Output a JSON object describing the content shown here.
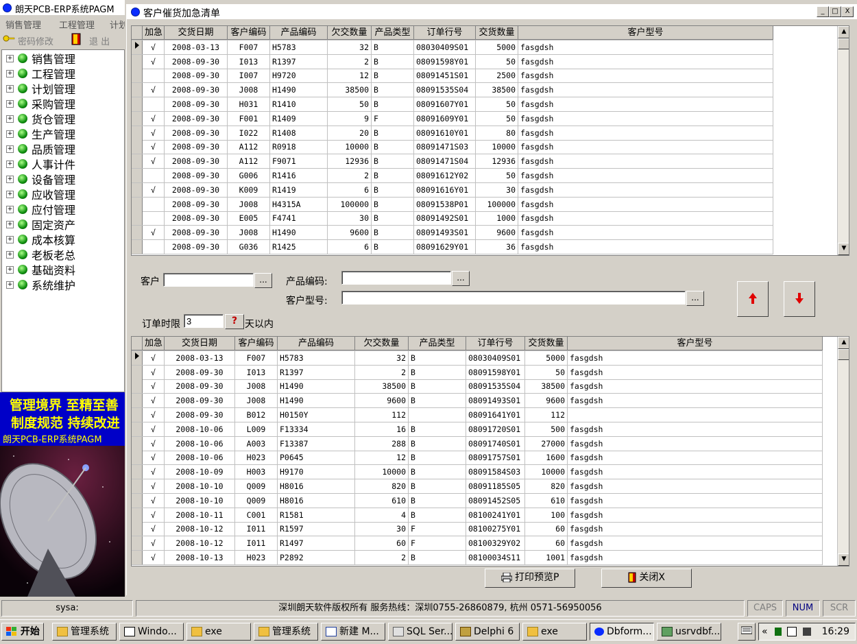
{
  "app": {
    "title": "朗天PCB-ERP系统PAGM",
    "menu": [
      "销售管理",
      "工程管理",
      "计划"
    ],
    "toolbar": {
      "password": "密码修改",
      "exit": "退 出"
    },
    "tree": [
      "销售管理",
      "工程管理",
      "计划管理",
      "采购管理",
      "货仓管理",
      "生产管理",
      "品质管理",
      "人事计件",
      "设备管理",
      "应收管理",
      "应付管理",
      "固定资产",
      "成本核算",
      "老板老总",
      "基础资料",
      "系统维护"
    ],
    "tree_expander": "+",
    "slogan": {
      "line1": "管理境界 至精至善",
      "line2": "制度规范 持续改进",
      "line3": "朗天PCB-ERP系统PAGM"
    }
  },
  "child": {
    "title": "客户催货加急清单",
    "controls": {
      "minimize": "_",
      "restore": "□",
      "close": "X"
    }
  },
  "grid1": {
    "columns": [
      "加急",
      "交货日期",
      "客户编码",
      "产品编码",
      "欠交数量",
      "产品类型",
      "订单行号",
      "交货数量",
      "客户型号"
    ],
    "rows": [
      [
        "√",
        "2008-03-13",
        "F007",
        "H5783",
        "32",
        "B",
        "08030409S01",
        "5000",
        "fasgdsh"
      ],
      [
        "√",
        "2008-09-30",
        "I013",
        "R1397",
        "2",
        "B",
        "08091598Y01",
        "50",
        "fasgdsh"
      ],
      [
        "",
        "2008-09-30",
        "I007",
        "H9720",
        "12",
        "B",
        "08091451S01",
        "2500",
        "fasgdsh"
      ],
      [
        "√",
        "2008-09-30",
        "J008",
        "H1490",
        "38500",
        "B",
        "08091535S04",
        "38500",
        "fasgdsh"
      ],
      [
        "",
        "2008-09-30",
        "H031",
        "R1410",
        "50",
        "B",
        "08091607Y01",
        "50",
        "fasgdsh"
      ],
      [
        "√",
        "2008-09-30",
        "F001",
        "R1409",
        "9",
        "F",
        "08091609Y01",
        "50",
        "fasgdsh"
      ],
      [
        "√",
        "2008-09-30",
        "I022",
        "R1408",
        "20",
        "B",
        "08091610Y01",
        "80",
        "fasgdsh"
      ],
      [
        "√",
        "2008-09-30",
        "A112",
        "R0918",
        "10000",
        "B",
        "08091471S03",
        "10000",
        "fasgdsh"
      ],
      [
        "√",
        "2008-09-30",
        "A112",
        "F9071",
        "12936",
        "B",
        "08091471S04",
        "12936",
        "fasgdsh"
      ],
      [
        "",
        "2008-09-30",
        "G006",
        "R1416",
        "2",
        "B",
        "08091612Y02",
        "50",
        "fasgdsh"
      ],
      [
        "√",
        "2008-09-30",
        "K009",
        "R1419",
        "6",
        "B",
        "08091616Y01",
        "30",
        "fasgdsh"
      ],
      [
        "",
        "2008-09-30",
        "J008",
        "H4315A",
        "100000",
        "B",
        "08091538P01",
        "100000",
        "fasgdsh"
      ],
      [
        "",
        "2008-09-30",
        "E005",
        "F4741",
        "30",
        "B",
        "08091492S01",
        "1000",
        "fasgdsh"
      ],
      [
        "√",
        "2008-09-30",
        "J008",
        "H1490",
        "9600",
        "B",
        "08091493S01",
        "9600",
        "fasgdsh"
      ],
      [
        "",
        "2008-09-30",
        "G036",
        "R1425",
        "6",
        "B",
        "08091629Y01",
        "36",
        "fasgdsh"
      ]
    ]
  },
  "filters": {
    "customer_label": "客户",
    "product_label": "产品编码:",
    "model_label": "客户型号:",
    "deadline_label": "订单时限",
    "deadline_value": "3",
    "deadline_suffix": "天以内",
    "browse": "...",
    "help_glyph": "?"
  },
  "grid2": {
    "columns": [
      "加急",
      "交货日期",
      "客户编码",
      "产品编码",
      "欠交数量",
      "产品类型",
      "订单行号",
      "交货数量",
      "客户型号"
    ],
    "rows": [
      [
        "√",
        "2008-03-13",
        "F007",
        "H5783",
        "32",
        "B",
        "08030409S01",
        "5000",
        "fasgdsh"
      ],
      [
        "√",
        "2008-09-30",
        "I013",
        "R1397",
        "2",
        "B",
        "08091598Y01",
        "50",
        "fasgdsh"
      ],
      [
        "√",
        "2008-09-30",
        "J008",
        "H1490",
        "38500",
        "B",
        "08091535S04",
        "38500",
        "fasgdsh"
      ],
      [
        "√",
        "2008-09-30",
        "J008",
        "H1490",
        "9600",
        "B",
        "08091493S01",
        "9600",
        "fasgdsh"
      ],
      [
        "√",
        "2008-09-30",
        "B012",
        "H0150Y",
        "112",
        "",
        "08091641Y01",
        "112",
        ""
      ],
      [
        "√",
        "2008-10-06",
        "L009",
        "F13334",
        "16",
        "B",
        "08091720S01",
        "500",
        "fasgdsh"
      ],
      [
        "√",
        "2008-10-06",
        "A003",
        "F13387",
        "288",
        "B",
        "08091740S01",
        "27000",
        "fasgdsh"
      ],
      [
        "√",
        "2008-10-06",
        "H023",
        "P0645",
        "12",
        "B",
        "08091757S01",
        "1600",
        "fasgdsh"
      ],
      [
        "√",
        "2008-10-09",
        "H003",
        "H9170",
        "10000",
        "B",
        "08091584S03",
        "10000",
        "fasgdsh"
      ],
      [
        "√",
        "2008-10-10",
        "Q009",
        "H8016",
        "820",
        "B",
        "08091185S05",
        "820",
        "fasgdsh"
      ],
      [
        "√",
        "2008-10-10",
        "Q009",
        "H8016",
        "610",
        "B",
        "08091452S05",
        "610",
        "fasgdsh"
      ],
      [
        "√",
        "2008-10-11",
        "C001",
        "R1581",
        "4",
        "B",
        "08100241Y01",
        "100",
        "fasgdsh"
      ],
      [
        "√",
        "2008-10-12",
        "I011",
        "R1597",
        "30",
        "F",
        "08100275Y01",
        "60",
        "fasgdsh"
      ],
      [
        "√",
        "2008-10-12",
        "I011",
        "R1497",
        "60",
        "F",
        "08100329Y02",
        "60",
        "fasgdsh"
      ],
      [
        "√",
        "2008-10-13",
        "H023",
        "P2892",
        "2",
        "B",
        "08100034S11",
        "1001",
        "fasgdsh"
      ]
    ]
  },
  "buttons": {
    "print_preview": "打印预览P",
    "close": "关闭X"
  },
  "status": {
    "user": "sysa:",
    "copyright": "深圳朗天软件版权所有  服务热线：深圳0755-26860879,  杭州 0571-56950056",
    "caps": "CAPS",
    "num": "NUM",
    "scr": "SCR"
  },
  "taskbar": {
    "start": "开始",
    "tasks": [
      "管理系统",
      "Windo...",
      "exe",
      "管理系统",
      "新建 M...",
      "SQL Ser...",
      "Delphi 6",
      "exe",
      "Dbform...",
      "usrvdbf..."
    ],
    "tray_chevron": "«",
    "time": "16:29"
  },
  "colors": {
    "accent": "#0a2cff",
    "slogan_bg": "#0000c8",
    "slogan_text": "#ffff00",
    "arrow_red": "#e00000"
  }
}
